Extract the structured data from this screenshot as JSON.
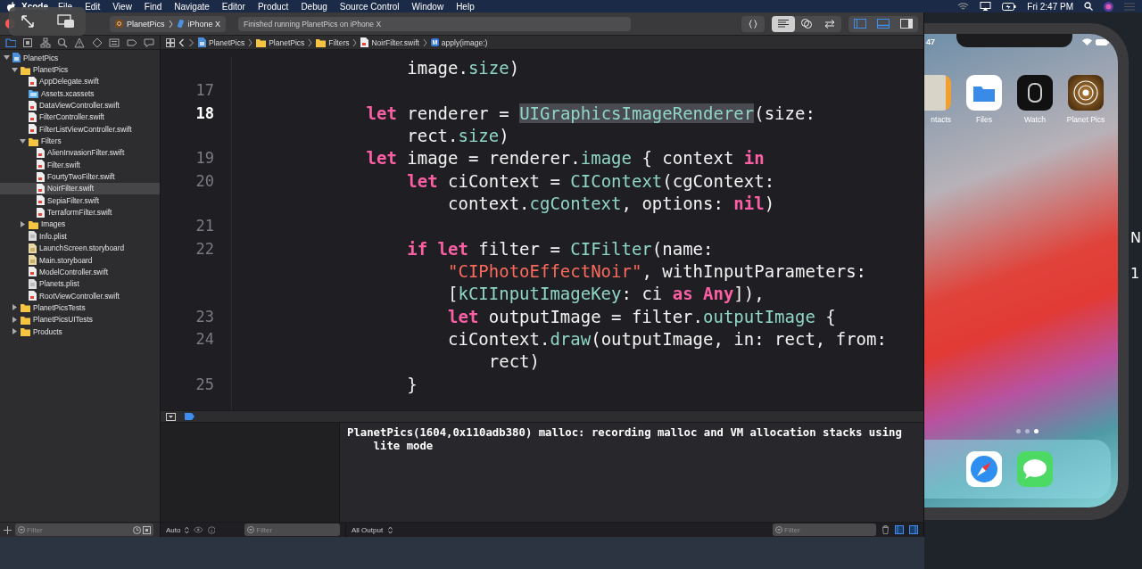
{
  "menu_bar": {
    "app": "Xcode",
    "menus": [
      "File",
      "Edit",
      "View",
      "Find",
      "Navigate",
      "Editor",
      "Product",
      "Debug",
      "Source Control",
      "Window",
      "Help"
    ],
    "clock": "Fri 2:47 PM"
  },
  "toolbar": {
    "scheme": "PlanetPics",
    "device": "iPhone X",
    "activity": "Finished running PlanetPics on iPhone X",
    "editor_modes": [
      {
        "kind": "standard",
        "selected": true
      },
      {
        "kind": "assistant",
        "selected": false
      },
      {
        "kind": "version",
        "selected": false
      }
    ],
    "panels": [
      {
        "kind": "left",
        "on": true
      },
      {
        "kind": "bottom",
        "on": true
      },
      {
        "kind": "right",
        "on": false
      }
    ]
  },
  "navigator": {
    "tabs": [
      {
        "kind": "folder",
        "selected": true
      },
      {
        "kind": "source",
        "selected": false
      },
      {
        "kind": "symbol",
        "selected": false
      },
      {
        "kind": "search",
        "selected": false
      },
      {
        "kind": "issue",
        "selected": false
      },
      {
        "kind": "test",
        "selected": false
      },
      {
        "kind": "debug",
        "selected": false
      },
      {
        "kind": "breakpoint",
        "selected": false
      },
      {
        "kind": "report",
        "selected": false
      }
    ],
    "tree": [
      {
        "kind": "project",
        "label": "PlanetPics",
        "expanded": true,
        "selected": false,
        "children": [
          {
            "kind": "folder",
            "label": "PlanetPics",
            "expanded": true,
            "selected": false,
            "children": [
              {
                "kind": "swift",
                "label": "AppDelegate.swift",
                "selected": false
              },
              {
                "kind": "assets",
                "label": "Assets.xcassets",
                "selected": false
              },
              {
                "kind": "swift",
                "label": "DataViewController.swift",
                "selected": false
              },
              {
                "kind": "swift",
                "label": "FilterController.swift",
                "selected": false
              },
              {
                "kind": "swift",
                "label": "FilterListViewController.swift",
                "selected": false
              },
              {
                "kind": "folder",
                "label": "Filters",
                "expanded": true,
                "selected": false,
                "children": [
                  {
                    "kind": "swift",
                    "label": "AlienInvasionFilter.swift",
                    "selected": false
                  },
                  {
                    "kind": "swift",
                    "label": "Filter.swift",
                    "selected": false
                  },
                  {
                    "kind": "swift",
                    "label": "FourtyTwoFilter.swift",
                    "selected": false
                  },
                  {
                    "kind": "swift",
                    "label": "NoirFilter.swift",
                    "selected": true
                  },
                  {
                    "kind": "swift",
                    "label": "SepiaFilter.swift",
                    "selected": false
                  },
                  {
                    "kind": "swift",
                    "label": "TerraformFilter.swift",
                    "selected": false
                  }
                ]
              },
              {
                "kind": "folder",
                "label": "Images",
                "expanded": false,
                "selected": false
              },
              {
                "kind": "plist",
                "label": "Info.plist",
                "selected": false
              },
              {
                "kind": "storyboard",
                "label": "LaunchScreen.storyboard",
                "selected": false
              },
              {
                "kind": "storyboard",
                "label": "Main.storyboard",
                "selected": false
              },
              {
                "kind": "swift",
                "label": "ModelController.swift",
                "selected": false
              },
              {
                "kind": "plist",
                "label": "Planets.plist",
                "selected": false
              },
              {
                "kind": "swift",
                "label": "RootViewController.swift",
                "selected": false
              }
            ]
          },
          {
            "kind": "folder",
            "label": "PlanetPicsTests",
            "expanded": false,
            "selected": false
          },
          {
            "kind": "folder",
            "label": "PlanetPicsUITests",
            "expanded": false,
            "selected": false
          },
          {
            "kind": "folder",
            "label": "Products",
            "expanded": false,
            "selected": false
          }
        ]
      }
    ],
    "filter": {
      "placeholder": "Filter"
    }
  },
  "jump_bar": {
    "crumbs": [
      {
        "kind": "project",
        "label": "PlanetPics"
      },
      {
        "kind": "folder",
        "label": "PlanetPics"
      },
      {
        "kind": "folder",
        "label": "Filters"
      },
      {
        "kind": "swift",
        "label": "NoirFilter.swift"
      },
      {
        "kind": "method",
        "badge": "M",
        "label": "apply(image:)"
      }
    ]
  },
  "editor": {
    "lines": [
      {
        "tokens": [
          {
            "kind": "plain",
            "text": "            image."
          },
          {
            "kind": "member",
            "text": "size"
          },
          {
            "kind": "plain",
            "text": ")"
          }
        ]
      },
      {
        "number": "17",
        "current": false
      },
      {
        "number": "18",
        "current": true,
        "tokens": [
          {
            "kind": "keyword",
            "text": "        let"
          },
          {
            "kind": "plain",
            "text": " renderer = "
          },
          {
            "kind": "type",
            "text": "UIGraphicsImageRenderer",
            "highlighted": true
          },
          {
            "kind": "plain",
            "text": "(size:"
          }
        ]
      },
      {
        "tokens": [
          {
            "kind": "plain",
            "text": "            rect."
          },
          {
            "kind": "member",
            "text": "size"
          },
          {
            "kind": "plain",
            "text": ")"
          }
        ]
      },
      {
        "number": "19",
        "current": false,
        "tokens": [
          {
            "kind": "keyword",
            "text": "        let"
          },
          {
            "kind": "plain",
            "text": " image = renderer."
          },
          {
            "kind": "member",
            "text": "image"
          },
          {
            "kind": "plain",
            "text": " { context "
          },
          {
            "kind": "keyword",
            "text": "in"
          }
        ]
      },
      {
        "number": "20",
        "current": false,
        "tokens": [
          {
            "kind": "keyword",
            "text": "            let"
          },
          {
            "kind": "plain",
            "text": " ciContext = "
          },
          {
            "kind": "type",
            "text": "CIContext"
          },
          {
            "kind": "plain",
            "text": "(cgContext:"
          }
        ]
      },
      {
        "tokens": [
          {
            "kind": "plain",
            "text": "                context."
          },
          {
            "kind": "member",
            "text": "cgContext"
          },
          {
            "kind": "plain",
            "text": ", options: "
          },
          {
            "kind": "keyword",
            "text": "nil"
          },
          {
            "kind": "plain",
            "text": ")"
          }
        ]
      },
      {
        "number": "21",
        "current": false
      },
      {
        "number": "22",
        "current": false,
        "tokens": [
          {
            "kind": "keyword",
            "text": "            if let"
          },
          {
            "kind": "plain",
            "text": " filter = "
          },
          {
            "kind": "type",
            "text": "CIFilter"
          },
          {
            "kind": "plain",
            "text": "(name:"
          }
        ]
      },
      {
        "tokens": [
          {
            "kind": "string",
            "text": "                \"CIPhotoEffectNoir\""
          },
          {
            "kind": "plain",
            "text": ", withInputParameters:"
          }
        ]
      },
      {
        "tokens": [
          {
            "kind": "plain",
            "text": "                ["
          },
          {
            "kind": "type",
            "text": "kCIInputImageKey"
          },
          {
            "kind": "plain",
            "text": ": ci "
          },
          {
            "kind": "keyword",
            "text": "as Any"
          },
          {
            "kind": "plain",
            "text": "]),"
          }
        ]
      },
      {
        "number": "23",
        "current": false,
        "tokens": [
          {
            "kind": "keyword",
            "text": "                let"
          },
          {
            "kind": "plain",
            "text": " outputImage = filter."
          },
          {
            "kind": "member",
            "text": "outputImage"
          },
          {
            "kind": "plain",
            "text": " {"
          }
        ]
      },
      {
        "number": "24",
        "current": false,
        "tokens": [
          {
            "kind": "plain",
            "text": "                ciContext."
          },
          {
            "kind": "member",
            "text": "draw"
          },
          {
            "kind": "plain",
            "text": "(outputImage, in: rect, from:"
          }
        ]
      },
      {
        "tokens": [
          {
            "kind": "plain",
            "text": "                    rect)"
          }
        ]
      },
      {
        "number": "25",
        "current": false,
        "tokens": [
          {
            "kind": "plain",
            "text": "            }"
          }
        ]
      }
    ]
  },
  "debug": {
    "scope": "Auto",
    "variables_filter": {
      "placeholder": "Filter"
    },
    "console_text": "PlanetPics(1604,0x110adb380) malloc: recording malloc and VM allocation stacks using lite mode",
    "output": "All Output",
    "console_filter": {
      "placeholder": "Filter"
    },
    "panes": [
      {
        "kind": "variables",
        "on": true
      },
      {
        "kind": "console",
        "on": true
      }
    ]
  },
  "simulator": {
    "status_time": "47",
    "apps": [
      {
        "kind": "contacts",
        "label": "ntacts"
      },
      {
        "kind": "files",
        "label": "Files"
      },
      {
        "kind": "watch",
        "label": "Watch"
      },
      {
        "kind": "planet",
        "label": "Planet Pics"
      }
    ],
    "page_dots": [
      {
        "selected": false
      },
      {
        "selected": false
      },
      {
        "selected": true
      }
    ],
    "dock": [
      {
        "kind": "safari"
      },
      {
        "kind": "messages"
      }
    ]
  },
  "background_text": [
    "N",
    "1"
  ]
}
